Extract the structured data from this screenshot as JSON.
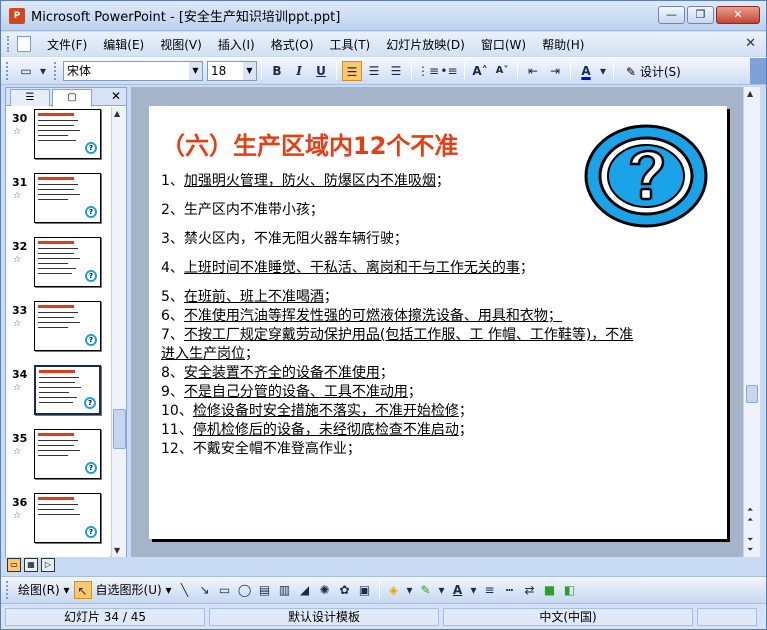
{
  "window": {
    "app_icon": "P",
    "title": "Microsoft PowerPoint - [安全生产知识培训ppt.ppt]",
    "controls": {
      "minimize": "—",
      "restore": "❐",
      "close": "✕"
    }
  },
  "menubar": {
    "items": [
      "文件(F)",
      "编辑(E)",
      "视图(V)",
      "插入(I)",
      "格式(O)",
      "工具(T)",
      "幻灯片放映(D)",
      "窗口(W)",
      "帮助(H)"
    ],
    "close_glyph": "✕"
  },
  "toolbar": {
    "font_name": "宋体",
    "font_size": "18",
    "bold": "B",
    "italic": "I",
    "underline": "U",
    "design_label": "设计(S)",
    "font_color": "#0000ff"
  },
  "panel": {
    "tab_outline_icon": "outline-icon",
    "tab_slides_icon": "slides-icon",
    "close_glyph": "✕",
    "thumbnails": [
      {
        "num": "30"
      },
      {
        "num": "31"
      },
      {
        "num": "32"
      },
      {
        "num": "33"
      },
      {
        "num": "34"
      },
      {
        "num": "35"
      },
      {
        "num": "36"
      }
    ],
    "selected": "34"
  },
  "slide": {
    "title": "（六）生产区域内12个不准",
    "lines": [
      {
        "prefix": "1、",
        "text": "加强明火管理，防火、防爆区内不准吸烟",
        "suffix": "；",
        "underline": true
      },
      {
        "prefix": "2、",
        "text": "生产区内不准带小孩；",
        "suffix": "",
        "underline": false
      },
      {
        "prefix": "3、",
        "text": "禁火区内，不准无阻火器车辆行驶；",
        "suffix": "",
        "underline": false
      },
      {
        "prefix": "4、",
        "text": "上班时间不准睡觉、干私活、离岗和干与工作无关的事",
        "suffix": "；",
        "underline": true
      },
      {
        "prefix": "5、",
        "text": "在班前、班上不准喝酒",
        "suffix": "；",
        "underline": true
      },
      {
        "prefix": "6、",
        "text": "不准使用汽油等挥发性强的可燃液体擦洗设备、用具和衣物；",
        "suffix": "",
        "underline": true
      },
      {
        "prefix": "7、",
        "text": "不按工厂规定穿戴劳动保护用品(包括工作服、工 作帽、工作鞋等)，不准",
        "suffix": "",
        "underline": true
      },
      {
        "prefix": "",
        "text": "进入生产岗位",
        "suffix": "；",
        "underline": true
      },
      {
        "prefix": "8、",
        "text": "安全装置不齐全的设备不准使用",
        "suffix": "；",
        "underline": true
      },
      {
        "prefix": "9、",
        "text": "不是自己分管的设备、工具不准动用",
        "suffix": "；",
        "underline": true
      },
      {
        "prefix": "10、",
        "text": "检修设备时安全措施不落实，不准开始检修",
        "suffix": "；",
        "underline": true
      },
      {
        "prefix": "11、",
        "text": "停机检修后的设备，未经彻底检查不准启动",
        "suffix": "；",
        "underline": true
      },
      {
        "prefix": "12、",
        "text": "不戴安全帽不准登高作业；",
        "suffix": "",
        "underline": false
      }
    ],
    "icon": "question-mark-icon",
    "title_color": "#e83d12",
    "icon_color": "#1aa3e8"
  },
  "drawbar": {
    "draw_label": "绘图(R)",
    "autoshape_label": "自选图形(U)"
  },
  "status": {
    "slide_info": "幻灯片 34 / 45",
    "template": "默认设计模板",
    "language": "中文(中国)"
  }
}
